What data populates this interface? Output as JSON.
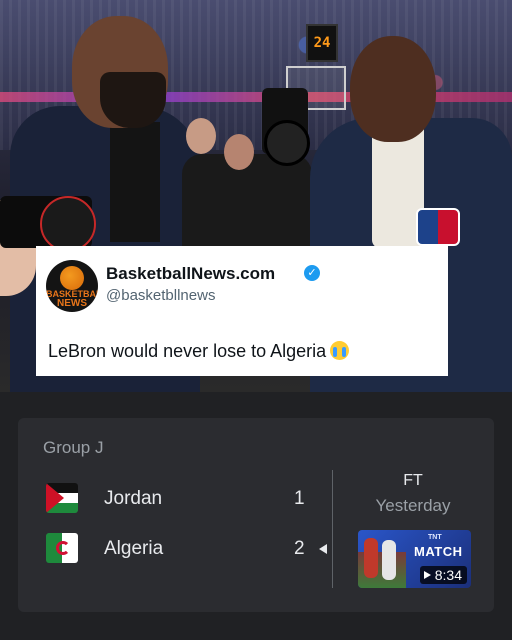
{
  "tweet": {
    "avatar_line1": "BASKETBALL",
    "avatar_line2": "NEWS",
    "display_name": "BasketballNews.com",
    "handle": "@basketbllnews",
    "text": "LeBron would never lose to Algeria"
  },
  "photo": {
    "shot_clock": "24"
  },
  "match": {
    "group": "Group J",
    "teams": [
      {
        "name": "Jordan",
        "score": "1",
        "flag": "jordan-flag-icon"
      },
      {
        "name": "Algeria",
        "score": "2",
        "flag": "algeria-flag-icon"
      }
    ],
    "status": "FT",
    "date": "Yesterday",
    "video": {
      "title": "MATCH",
      "duration": "8:34"
    }
  },
  "colors": {
    "verified": "#1d9bf0",
    "card_bg": "#2b2c30",
    "page_bg": "#202124"
  }
}
